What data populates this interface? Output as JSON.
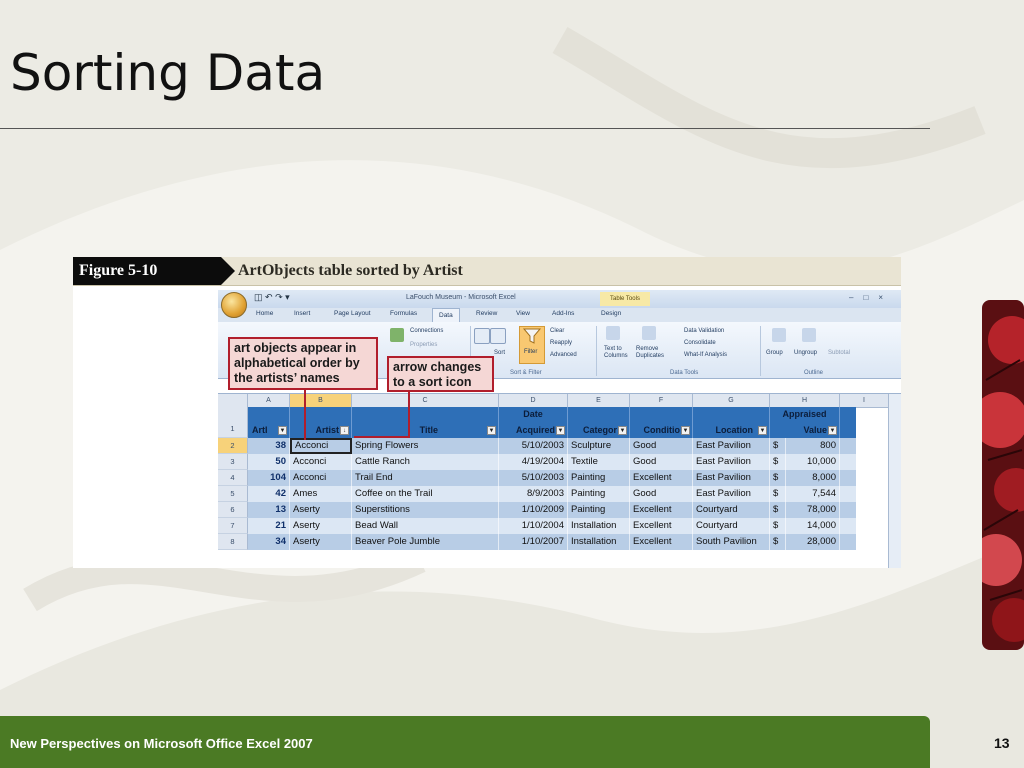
{
  "slide": {
    "title": "Sorting Data",
    "footer": "New Perspectives on Microsoft Office Excel 2007",
    "page_number": "13"
  },
  "figure": {
    "label": "Figure 5-10",
    "caption": "ArtObjects table sorted by Artist"
  },
  "excel": {
    "window_title": "LaFouch Museum - Microsoft Excel",
    "context_tab": "Table Tools",
    "tabs": [
      "Home",
      "Insert",
      "Page Layout",
      "Formulas",
      "Data",
      "Review",
      "View",
      "Add-Ins",
      "Design"
    ],
    "active_tab": "Data",
    "ribbon": {
      "connections": "Connections",
      "properties": "Properties",
      "sort": "Sort",
      "filter": "Filter",
      "clear": "Clear",
      "reapply": "Reapply",
      "advanced": "Advanced",
      "text_to_columns": "Text to Columns",
      "remove_duplicates": "Remove Duplicates",
      "data_validation": "Data Validation",
      "consolidate": "Consolidate",
      "what_if": "What-If Analysis",
      "group": "Group",
      "ungroup": "Ungroup",
      "subtotal": "Subtotal",
      "group_sort_filter": "Sort & Filter",
      "group_data_tools": "Data Tools",
      "group_outline": "Outline"
    },
    "column_letters": [
      "A",
      "B",
      "C",
      "D",
      "E",
      "F",
      "G",
      "H",
      "I"
    ],
    "headers": {
      "artid": "ArtI",
      "artist": "Artist",
      "title": "Title",
      "date_line1": "Date",
      "date_line2": "Acquired",
      "category": "Categor",
      "condition": "Conditio",
      "location": "Location",
      "value_line1": "Appraised",
      "value_line2": "Value"
    },
    "row_numbers": [
      "1",
      "2",
      "3",
      "4",
      "5",
      "6",
      "7",
      "8"
    ],
    "rows": [
      {
        "id": "38",
        "artist": "Acconci",
        "title": "Spring Flowers",
        "date": "5/10/2003",
        "category": "Sculpture",
        "condition": "Good",
        "location": "East Pavilion",
        "currency": "$",
        "value": "800"
      },
      {
        "id": "50",
        "artist": "Acconci",
        "title": "Cattle Ranch",
        "date": "4/19/2004",
        "category": "Textile",
        "condition": "Good",
        "location": "East Pavilion",
        "currency": "$",
        "value": "10,000"
      },
      {
        "id": "104",
        "artist": "Acconci",
        "title": "Trail End",
        "date": "5/10/2003",
        "category": "Painting",
        "condition": "Excellent",
        "location": "East Pavilion",
        "currency": "$",
        "value": "8,000"
      },
      {
        "id": "42",
        "artist": "Ames",
        "title": "Coffee on the Trail",
        "date": "8/9/2003",
        "category": "Painting",
        "condition": "Good",
        "location": "East Pavilion",
        "currency": "$",
        "value": "7,544"
      },
      {
        "id": "13",
        "artist": "Aserty",
        "title": "Superstitions",
        "date": "1/10/2009",
        "category": "Painting",
        "condition": "Excellent",
        "location": "Courtyard",
        "currency": "$",
        "value": "78,000"
      },
      {
        "id": "21",
        "artist": "Aserty",
        "title": "Bead Wall",
        "date": "1/10/2004",
        "category": "Installation",
        "condition": "Excellent",
        "location": "Courtyard",
        "currency": "$",
        "value": "14,000"
      },
      {
        "id": "34",
        "artist": "Aserty",
        "title": "Beaver Pole Jumble",
        "date": "1/10/2007",
        "category": "Installation",
        "condition": "Excellent",
        "location": "South Pavilion",
        "currency": "$",
        "value": "28,000"
      }
    ]
  },
  "callouts": {
    "left": "art objects appear in alphabetical order by the artists’ names",
    "right": "arrow changes to a sort icon"
  },
  "colors": {
    "footer": "#4b7a24",
    "header_fill": "#2e6fb7",
    "callout_border": "#b11e2c",
    "callout_fill": "#f5d7d5"
  }
}
